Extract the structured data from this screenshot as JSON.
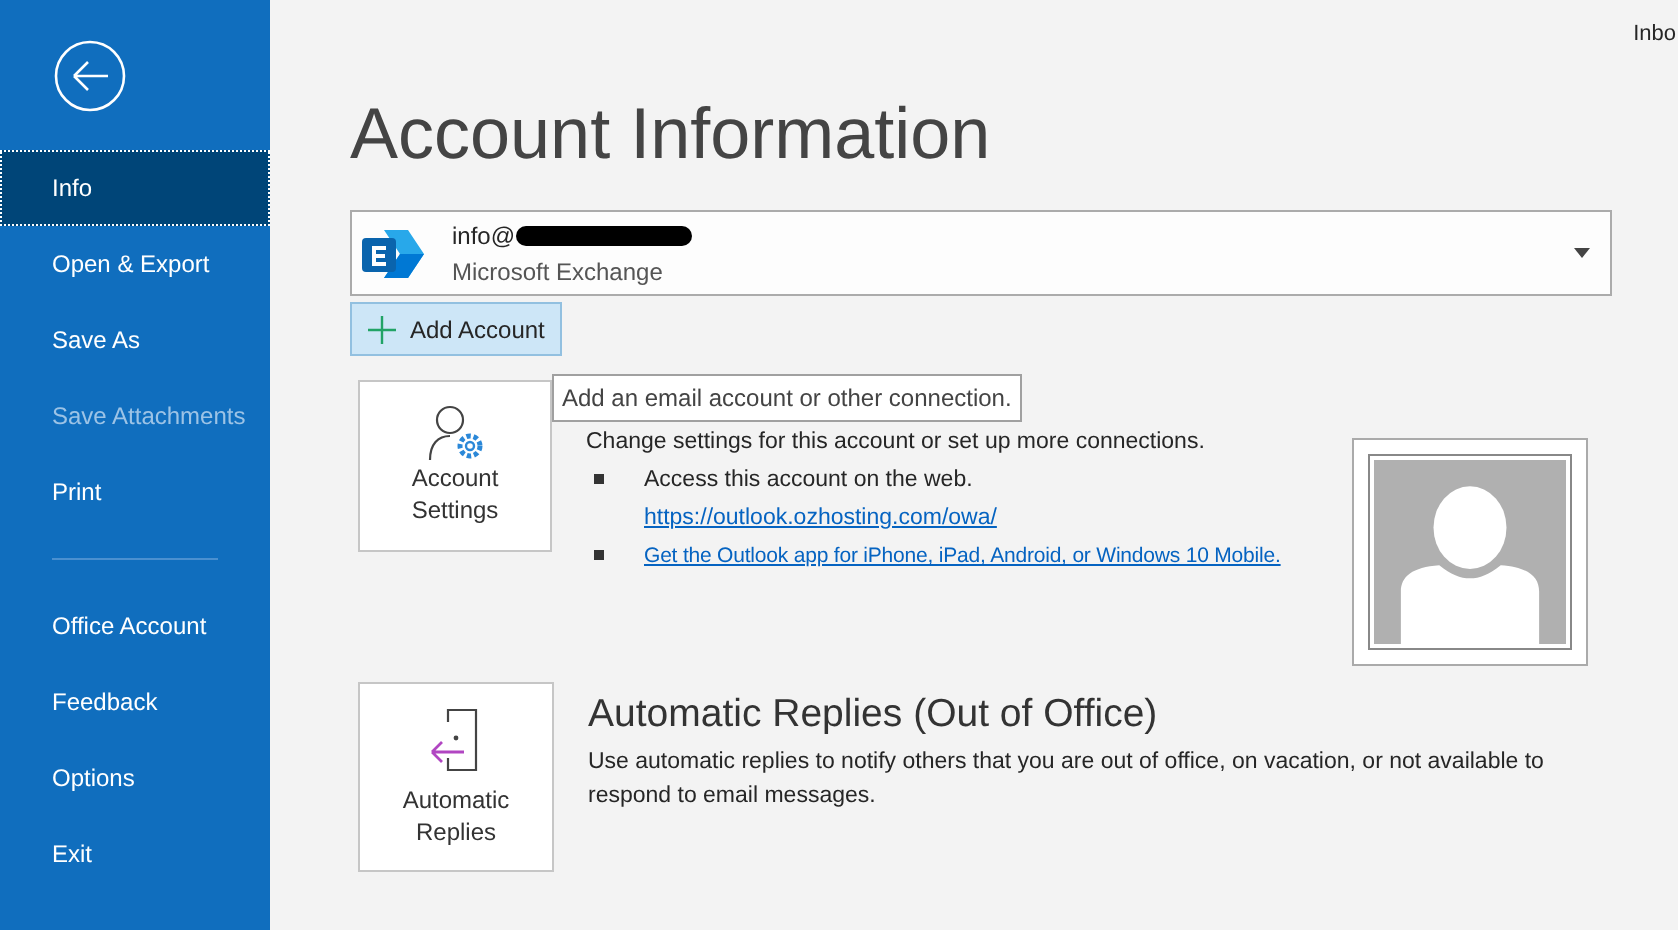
{
  "window": {
    "title_fragment": "Inbo"
  },
  "sidebar": {
    "items": [
      {
        "kind": "item",
        "label": "Info",
        "selected": true,
        "disabled": false
      },
      {
        "kind": "item",
        "label": "Open & Export",
        "selected": false,
        "disabled": false
      },
      {
        "kind": "item",
        "label": "Save As",
        "selected": false,
        "disabled": false
      },
      {
        "kind": "item",
        "label": "Save Attachments",
        "selected": false,
        "disabled": true
      },
      {
        "kind": "item",
        "label": "Print",
        "selected": false,
        "disabled": false
      },
      {
        "kind": "divider"
      },
      {
        "kind": "item",
        "label": "Office Account",
        "selected": false,
        "disabled": false
      },
      {
        "kind": "item",
        "label": "Feedback",
        "selected": false,
        "disabled": false
      },
      {
        "kind": "item",
        "label": "Options",
        "selected": false,
        "disabled": false
      },
      {
        "kind": "item",
        "label": "Exit",
        "selected": false,
        "disabled": false
      }
    ]
  },
  "page_title": "Account Information",
  "account": {
    "email": "info@",
    "type": "Microsoft Exchange"
  },
  "add_account_button": {
    "label": "Add Account"
  },
  "tooltip": "Add an email account or other connection.",
  "account_settings": {
    "tile_label": "Account Settings",
    "description": "Change settings for this account or set up more connections.",
    "bullets": [
      {
        "kind": "text_with_link",
        "text": "Access this account on the web.",
        "link": "https://outlook.ozhosting.com/owa/"
      },
      {
        "kind": "link",
        "link": "Get the Outlook app for iPhone, iPad, Android, or Windows 10 Mobile."
      }
    ]
  },
  "automatic_replies": {
    "tile_label": "Automatic Replies",
    "heading": "Automatic Replies (Out of Office)",
    "description": "Use automatic replies to notify others that you are out of office, on vacation, or not available to respond to email messages."
  }
}
